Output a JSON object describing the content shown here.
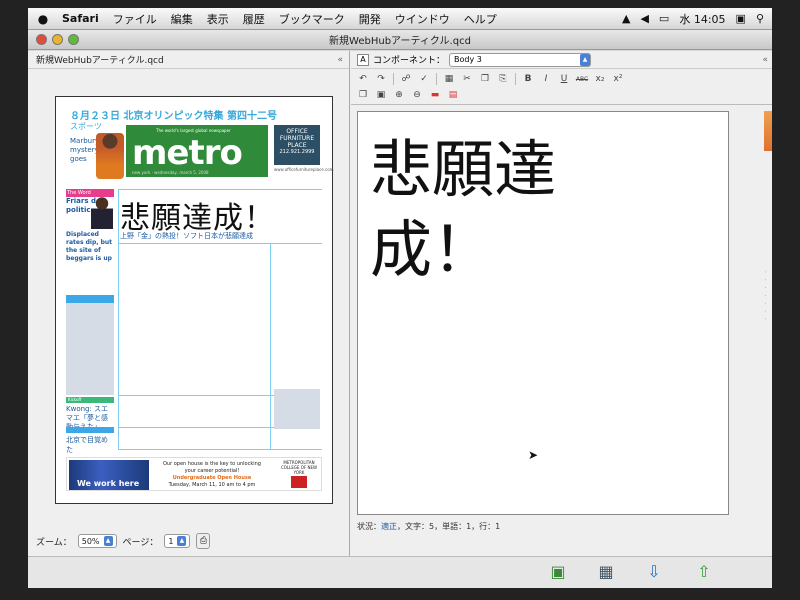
{
  "menubar": {
    "app": "Safari",
    "items": [
      "ファイル",
      "編集",
      "表示",
      "履歴",
      "ブックマーク",
      "開発",
      "ウインドウ",
      "ヘルプ"
    ],
    "clock": "水 14:05"
  },
  "window": {
    "title": "新規WebHubアーティクル.qcd"
  },
  "left_pane": {
    "header": "新規WebHubアーティクル.qcd",
    "page": {
      "masthead_line": "８月２３日 北京オリンピック特集 第四十二号",
      "sports_label": "スポーツ",
      "marbury_text": "Marbury mystery goes",
      "metro_tagline": "The world's largest global newspaper",
      "metro_logo": "metro",
      "metro_date": "new york · wednesday, march 5, 2008",
      "office_title": "OFFICE",
      "office_sub": "FURNITURE",
      "office_place": "PLACE",
      "office_phone": "212.921.2999",
      "under_office": "www.officefurnitureplace.com",
      "theword_label": "The Word",
      "friars_text": "Friars do politic...",
      "displaced_text": "Displaced rates dip, but the site of beggars is up",
      "headline": "悲願達成！",
      "subhead": "上野「金」の熱投！ソフト日本が悲願達成",
      "kwong_tag": "Kickoff",
      "kwong_text": "Kwong: スエマエ「夢と感動与えた」",
      "beijing_text": "北京で目覚めた",
      "ad_caption": "We work here",
      "ad_line1": "Our open house is the key to unlocking your career potential!",
      "ad_line2": "Undergraduate Open House",
      "ad_line3": "Tuesday, March 11, 10 am to 4 pm",
      "ad_logo_text": "METROPOLITAN COLLEGE OF NEW YORK"
    },
    "footer": {
      "zoom_label": "ズーム：",
      "zoom_value": "50%",
      "page_label": "ページ：",
      "page_value": "1"
    }
  },
  "right_pane": {
    "component_label": "コンポーネント：",
    "component_value": "Body 3",
    "toolbar": {
      "bold": "B",
      "italic": "I",
      "underline": "U",
      "strike": "ABC",
      "subscript": "x₂",
      "superscript": "x²"
    },
    "editor_text": "悲願達成！",
    "status_prefix": "状況：",
    "status_ok": "適正",
    "status_rest": "，文字：5，単語：1，行：1"
  },
  "icons": {
    "apple": "apple-icon",
    "wifi": "wifi-icon",
    "volume": "volume-icon",
    "battery": "battery-icon",
    "search": "search-icon"
  },
  "colors": {
    "metro_green": "#2f8a3a",
    "masthead_blue": "#38a8d8",
    "status_blue": "#1a5aa0"
  }
}
